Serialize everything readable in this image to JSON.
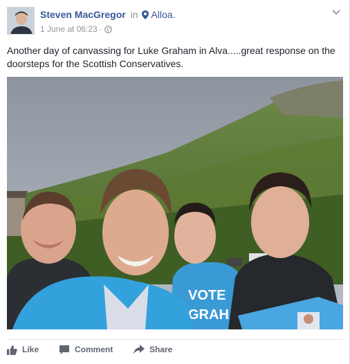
{
  "post": {
    "author": "Steven MacGregor",
    "in_word": "in",
    "location": "Alloa.",
    "timestamp": "1 June at 06:23",
    "separator": "·",
    "text": "Another day of canvassing for Luke Graham in Alva.....great response on the doorsteps for the Scottish Conservatives.",
    "photo_leaflet_text": [
      "VOTE",
      "GRAHAM"
    ]
  },
  "actions": {
    "like": "Like",
    "comment": "Comment",
    "share": "Share"
  },
  "colors": {
    "link": "#365899",
    "meta": "#90949c",
    "action": "#606770",
    "shirt_blue": "#3a9ad6"
  },
  "icons": [
    "map-pin-icon",
    "globe-icon",
    "chevron-down-icon",
    "like-thumb-icon",
    "comment-bubble-icon",
    "share-arrow-icon"
  ]
}
